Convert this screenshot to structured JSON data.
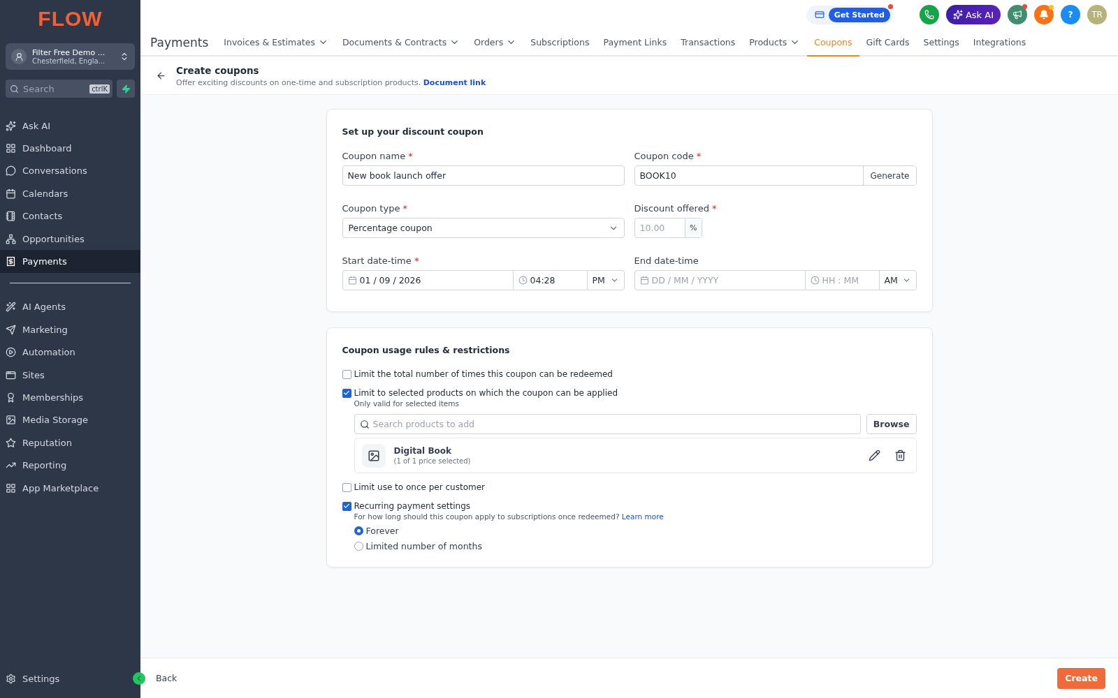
{
  "logo": "FLOW",
  "account": {
    "name": "Filter Free Demo ...",
    "location": "Chesterfield, Engla..."
  },
  "sidebar_search": {
    "placeholder": "Search",
    "shortcut": "ctrlK"
  },
  "sidebar": {
    "items": [
      {
        "label": "Ask AI",
        "selected": false
      },
      {
        "label": "Dashboard",
        "selected": false
      },
      {
        "label": "Conversations",
        "selected": false
      },
      {
        "label": "Calendars",
        "selected": false
      },
      {
        "label": "Contacts",
        "selected": false
      },
      {
        "label": "Opportunities",
        "selected": false
      },
      {
        "label": "Payments",
        "selected": true
      }
    ],
    "items_2": [
      {
        "label": "AI Agents",
        "selected": false
      },
      {
        "label": "Marketing",
        "selected": false
      },
      {
        "label": "Automation",
        "selected": false
      },
      {
        "label": "Sites",
        "selected": false
      },
      {
        "label": "Memberships",
        "selected": false
      },
      {
        "label": "Media Storage",
        "selected": false
      },
      {
        "label": "Reputation",
        "selected": false
      },
      {
        "label": "Reporting",
        "selected": false
      },
      {
        "label": "App Marketplace",
        "selected": false
      }
    ],
    "footer_item": "Settings"
  },
  "topbar": {
    "get_started": "Get Started",
    "ask_ai": "Ask AI",
    "help": "?",
    "avatar": "TR"
  },
  "nav": {
    "title": "Payments",
    "tabs": [
      {
        "label": "Invoices & Estimates",
        "dropdown": true,
        "selected": false
      },
      {
        "label": "Documents & Contracts",
        "dropdown": true,
        "selected": false
      },
      {
        "label": "Orders",
        "dropdown": true,
        "selected": false
      },
      {
        "label": "Subscriptions",
        "dropdown": false,
        "selected": false
      },
      {
        "label": "Payment Links",
        "dropdown": false,
        "selected": false
      },
      {
        "label": "Transactions",
        "dropdown": false,
        "selected": false
      },
      {
        "label": "Products",
        "dropdown": true,
        "selected": false
      },
      {
        "label": "Coupons",
        "dropdown": false,
        "selected": true
      },
      {
        "label": "Gift Cards",
        "dropdown": false,
        "selected": false
      },
      {
        "label": "Settings",
        "dropdown": false,
        "selected": false
      },
      {
        "label": "Integrations",
        "dropdown": false,
        "selected": false
      }
    ]
  },
  "header": {
    "title": "Create coupons",
    "subtitle": "Offer exciting discounts on one-time and subscription products.",
    "link": "Document link"
  },
  "setup": {
    "title": "Set up your discount coupon",
    "fields": [
      {
        "kind": "text",
        "label": "Coupon name",
        "required_mark": "*",
        "value": "New book launch offer"
      },
      {
        "kind": "code",
        "label": "Coupon code",
        "required_mark": "*",
        "value": "BOOK10",
        "button": "Generate"
      },
      {
        "kind": "select",
        "label": "Coupon type",
        "required_mark": "*",
        "value": "Percentage coupon"
      },
      {
        "kind": "suffix",
        "label": "Discount offered",
        "required_mark": "*",
        "placeholder": "10.00",
        "suffix": "%"
      },
      {
        "kind": "datetime",
        "label": "Start date-time",
        "required_mark": "*",
        "date": "01 / 09 / 2026",
        "time": "04:28",
        "meridiem": "PM"
      },
      {
        "kind": "datetime",
        "label": "End date-time",
        "date_placeholder": "DD / MM / YYYY",
        "time_placeholder": "HH : MM",
        "meridiem": "AM"
      }
    ]
  },
  "rules": {
    "title": "Coupon usage rules & restrictions",
    "items": [
      {
        "kind": "plain",
        "label": "Limit the total number of times this coupon can be redeemed",
        "checked": false
      },
      {
        "kind": "products",
        "label": "Limit to selected products on which the coupon can be applied",
        "checked": true,
        "hint": "Only valid for selected items",
        "search_placeholder": "Search products to add",
        "browse": "Browse",
        "product": {
          "name": "Digital Book",
          "detail": "(1 of 1 price selected)"
        }
      },
      {
        "kind": "plain",
        "label": "Limit use to once per customer",
        "checked": false
      },
      {
        "kind": "recurring",
        "label": "Recurring payment settings",
        "checked": true,
        "hint": "For how long should this coupon apply to subscriptions once redeemed?",
        "link": "Learn more",
        "options": [
          {
            "label": "Forever",
            "selected": true
          },
          {
            "label": "Limited number of months",
            "selected": false
          }
        ]
      }
    ]
  },
  "footer": {
    "back": "Back",
    "create": "Create"
  }
}
